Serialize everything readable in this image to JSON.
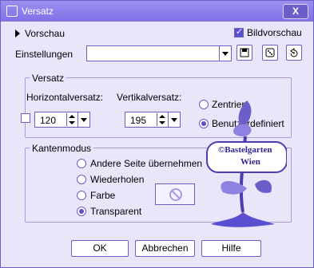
{
  "window": {
    "title": "Versatz",
    "close_label": "X"
  },
  "preview": {
    "label": "Vorschau",
    "bildvorschau_label": "Bildvorschau",
    "bildvorschau_checked": true
  },
  "settings": {
    "label": "Einstellungen",
    "value": ""
  },
  "offset_group": {
    "title": "Versatz",
    "horizontal_label": "Horizontalversatz:",
    "horizontal_value": "120",
    "vertical_label": "Vertikalversatz:",
    "vertical_value": "195",
    "centered_label": "Zentriert",
    "custom_label": "Benutzerdefiniert",
    "selected": "custom"
  },
  "edge_group": {
    "title": "Kantenmodus",
    "options": [
      {
        "label": "Andere Seite übernehmen",
        "selected": false
      },
      {
        "label": "Wiederholen",
        "selected": false
      },
      {
        "label": "Farbe",
        "selected": false
      },
      {
        "label": "Transparent",
        "selected": true
      }
    ]
  },
  "watermark": {
    "line1": "©Bastelgarten",
    "line2": "Wien"
  },
  "buttons": {
    "ok": "OK",
    "cancel": "Abbrechen",
    "help": "Hilfe"
  },
  "colors": {
    "accent": "#5b4fd1",
    "border": "#6a5fc8",
    "background": "#e9e6fa"
  }
}
